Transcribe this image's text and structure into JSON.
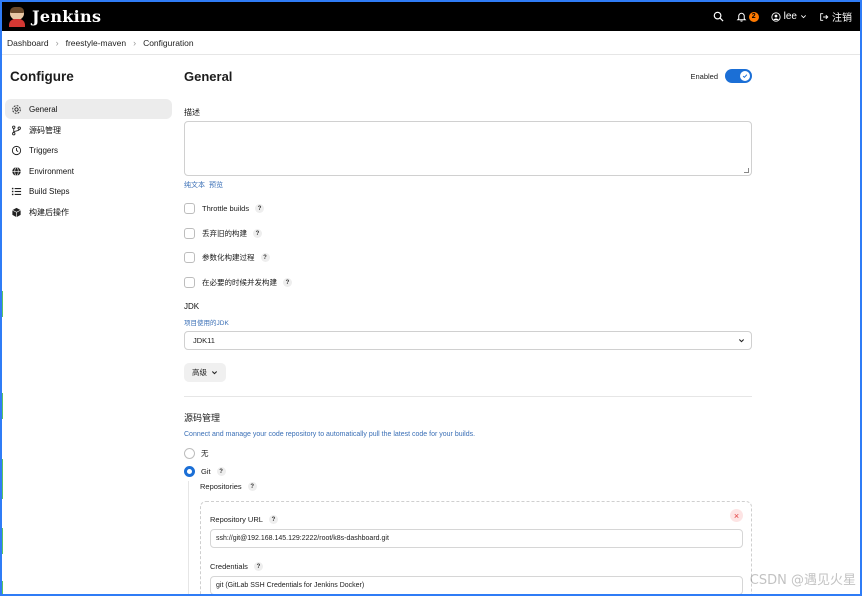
{
  "header": {
    "brand": "Jenkins",
    "notification_count": "2",
    "user": "lee",
    "logout": "注销"
  },
  "breadcrumb": [
    "Dashboard",
    "freestyle-maven",
    "Configuration"
  ],
  "sidebar": {
    "title": "Configure",
    "items": [
      {
        "label": "General",
        "icon": "gear-icon"
      },
      {
        "label": "源码管理",
        "icon": "branch-icon"
      },
      {
        "label": "Triggers",
        "icon": "clock-icon"
      },
      {
        "label": "Environment",
        "icon": "globe-icon"
      },
      {
        "label": "Build Steps",
        "icon": "list-icon"
      },
      {
        "label": "构建后操作",
        "icon": "cube-icon"
      }
    ]
  },
  "general": {
    "title": "General",
    "enabled_label": "Enabled",
    "description_label": "描述",
    "richtext_label": "纯文本",
    "preview_label": "预览",
    "checkboxes": [
      "Throttle builds",
      "丢弃旧的构建",
      "参数化构建过程",
      "在必要的时候并发构建"
    ],
    "jdk_label": "JDK",
    "jdk_hint": "项目使用的JDK",
    "jdk_value": "JDK11",
    "advanced_label": "高级"
  },
  "scm": {
    "title": "源码管理",
    "description": "Connect and manage your code repository to automatically pull the latest code for your builds.",
    "option_none": "无",
    "option_git": "Git",
    "repositories_label": "Repositories",
    "repo_url_label": "Repository URL",
    "repo_url_value": "ssh://git@192.168.145.129:2222/root/k8s-dashboard.git",
    "credentials_label": "Credentials",
    "credentials_value": "git (GitLab SSH Credentials for Jenkins Docker)"
  },
  "watermark": "CSDN @遇见火星",
  "help_glyph": "?"
}
